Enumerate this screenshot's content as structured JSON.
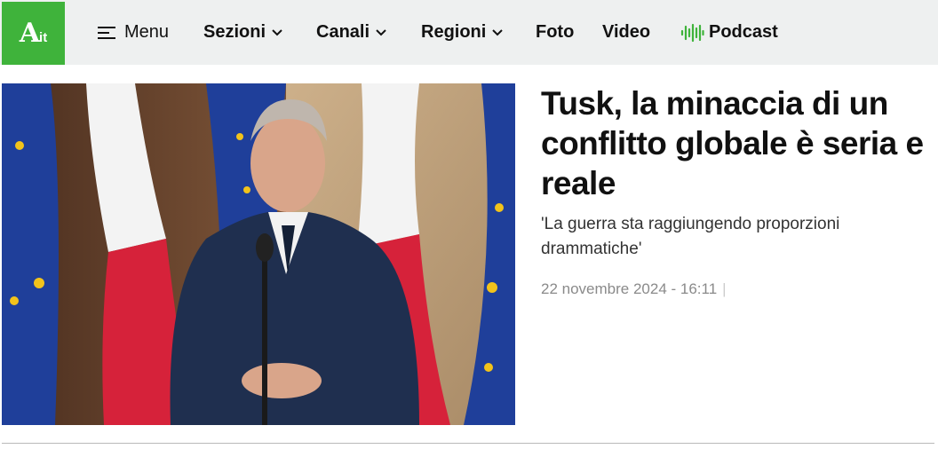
{
  "logo": {
    "main": "A",
    "sub": "it"
  },
  "nav": {
    "menu": "Menu",
    "sezioni": "Sezioni",
    "canali": "Canali",
    "regioni": "Regioni",
    "foto": "Foto",
    "video": "Video",
    "podcast": "Podcast"
  },
  "article": {
    "title": "Tusk, la minaccia di un conflitto globale è seria e reale",
    "subtitle": "'La guerra sta raggiungendo proporzioni drammatiche'",
    "date": "22 novembre 2024 - 16:11",
    "separator": "|"
  },
  "colors": {
    "brand_green": "#3fb33b",
    "topbar_bg": "#eef0f0"
  }
}
